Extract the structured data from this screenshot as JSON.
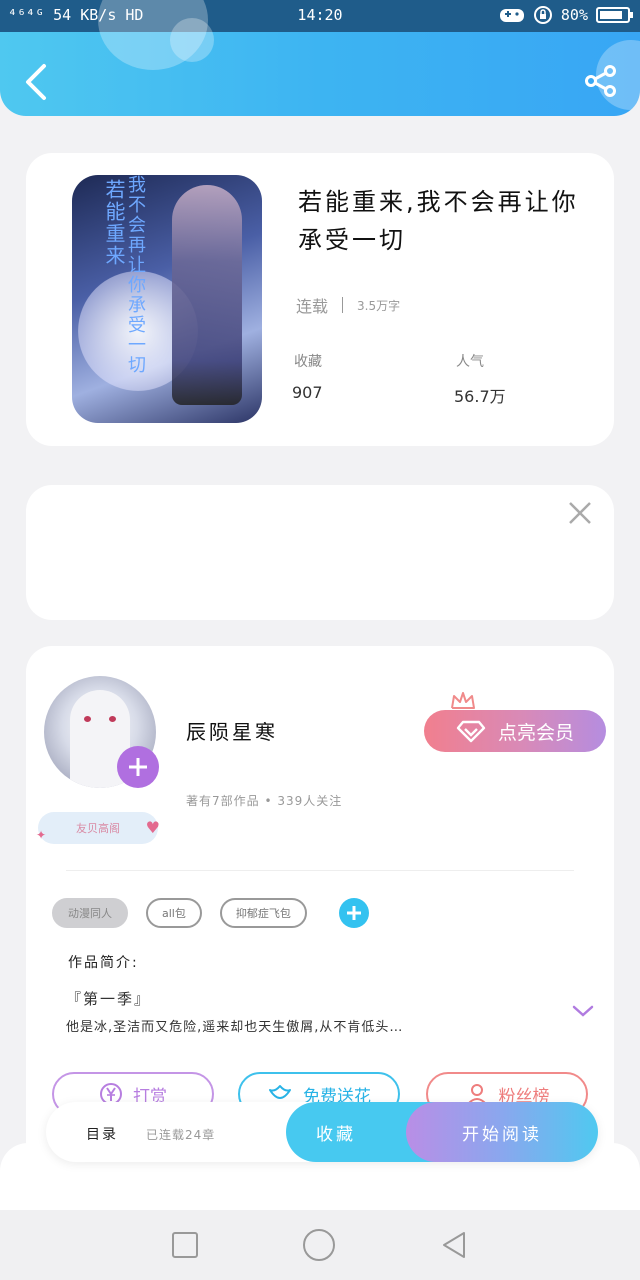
{
  "status_bar": {
    "network": "⁴⁶⁴ᴳ",
    "speed": "54 KB/s",
    "hd": "HD",
    "time": "14:20",
    "battery": "80%"
  },
  "header": {
    "back_icon": "chevron-left-icon",
    "share_icon": "share-icon"
  },
  "book": {
    "title": "若能重来,我不会再让你承受一切",
    "cover_text_left": "若能重来",
    "cover_text_right": "我不会再让你承受一切",
    "status": "连载",
    "word_count": "3.5万字",
    "stats": [
      {
        "label": "收藏",
        "value": "907"
      },
      {
        "label": "人气",
        "value": "56.7万"
      }
    ]
  },
  "author": {
    "name": "辰陨星寒",
    "meta": "著有7部作品 • 339人关注",
    "badge": "友贝高阁",
    "vip_label": "点亮会员",
    "tags": [
      "动漫同人",
      "all包",
      "抑郁症飞包"
    ],
    "intro_label": "作品简介:",
    "intro_season": "『第一季』",
    "intro_text": "他是冰,圣洁而又危险,遥来却也天生傲屑,从不肯低头…"
  },
  "actions": {
    "reward": "打赏",
    "flower": "免费送花",
    "fans": "粉丝榜"
  },
  "bottom_bar": {
    "toc": "目录",
    "serial": "已连载24章",
    "collect": "收藏",
    "read": "开始阅读"
  },
  "colors": {
    "header_gradient": [
      "#4fc8f0",
      "#38a6f4"
    ],
    "accent_blue": "#33c2f0",
    "accent_purple": "#b06fe0",
    "vip_gradient": [
      "#f17f8e",
      "#b58de0"
    ]
  }
}
